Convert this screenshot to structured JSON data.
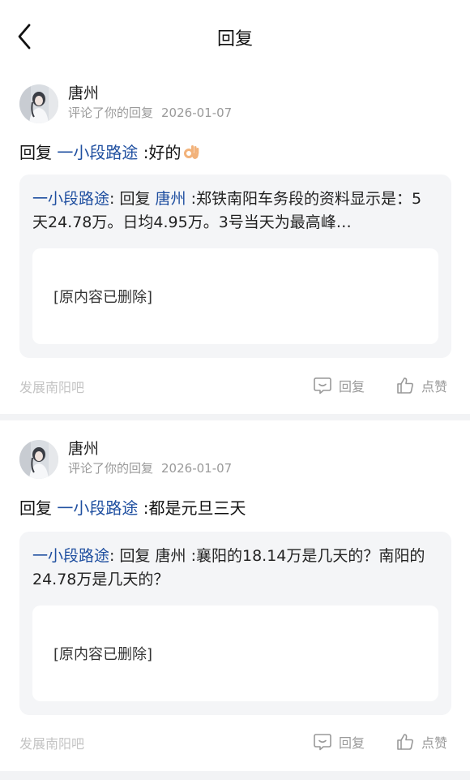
{
  "header": {
    "title": "回复"
  },
  "comments": [
    {
      "user": "唐州",
      "action_text": "评论了你的回复",
      "date": "2026-01-07",
      "reply_prefix": "回复",
      "reply_target": "一小段路途",
      "reply_body": ":好的",
      "has_emoji": true,
      "quote_author": "一小段路途",
      "quote_sep": ": 回复",
      "quote_target": "唐州",
      "quote_body": ":郑铁南阳车务段的资料显示是：5天24.78万。日均4.95万。3号当天为最高峰…",
      "deleted_text": "[原内容已删除]",
      "source": "发展南阳吧",
      "reply_label": "回复",
      "like_label": "点赞"
    },
    {
      "user": "唐州",
      "action_text": "评论了你的回复",
      "date": "2026-01-07",
      "reply_prefix": "回复",
      "reply_target": "一小段路途",
      "reply_body": ":都是元旦三天",
      "has_emoji": false,
      "quote_author": "一小段路途",
      "quote_sep": ": 回复",
      "quote_target": "唐州",
      "quote_body": ":襄阳的18.14万是几天的？南阳的24.78万是几天的？",
      "deleted_text": "[原内容已删除]",
      "source": "发展南阳吧",
      "reply_label": "回复",
      "like_label": "点赞"
    }
  ],
  "colors": {
    "link": "#1f4fa0",
    "separator": "#f2f3f5",
    "quote_bg": "#f4f5f7",
    "muted": "#9a9a9a"
  },
  "icons": [
    "back-arrow-icon",
    "avatar-image",
    "ok-hand-emoji-icon",
    "comment-icon",
    "thumbs-up-icon"
  ]
}
